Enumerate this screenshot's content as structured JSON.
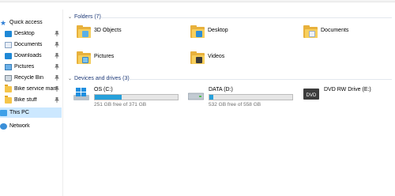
{
  "sidebar": {
    "quick_access": "Quick access",
    "items": [
      {
        "label": "Desktop",
        "icon": "desktop-icon",
        "pinned": true
      },
      {
        "label": "Documents",
        "icon": "documents-icon",
        "pinned": true
      },
      {
        "label": "Downloads",
        "icon": "downloads-icon",
        "pinned": true
      },
      {
        "label": "Pictures",
        "icon": "pictures-icon",
        "pinned": true
      },
      {
        "label": "Recycle Bin",
        "icon": "recycle-bin-icon",
        "pinned": true
      },
      {
        "label": "Bike service man",
        "icon": "folder-icon",
        "pinned": true
      },
      {
        "label": "Bike stuff",
        "icon": "folder-icon",
        "pinned": true
      }
    ],
    "this_pc": "This PC",
    "network": "Network"
  },
  "folders": {
    "header": "Folders (7)",
    "items": [
      {
        "name": "3D Objects",
        "icon": "3d-objects-folder-icon"
      },
      {
        "name": "Desktop",
        "icon": "desktop-folder-icon"
      },
      {
        "name": "Documents",
        "icon": "documents-folder-icon"
      },
      {
        "name": "Pictures",
        "icon": "pictures-folder-icon"
      },
      {
        "name": "Videos",
        "icon": "videos-folder-icon"
      }
    ]
  },
  "drives": {
    "header": "Devices and drives (3)",
    "items": [
      {
        "name": "OS (C:)",
        "free": "251 GB free of 371 GB",
        "used_fraction": 0.32
      },
      {
        "name": "DATA (D:)",
        "free": "532 GB free of 558 GB",
        "used_fraction": 0.05
      },
      {
        "name": "DVD RW Drive (E:)",
        "icon_text": "DVD"
      }
    ]
  },
  "colors": {
    "accent": "#26a0da",
    "selection": "#cce8ff",
    "group_header": "#1e3a78"
  }
}
